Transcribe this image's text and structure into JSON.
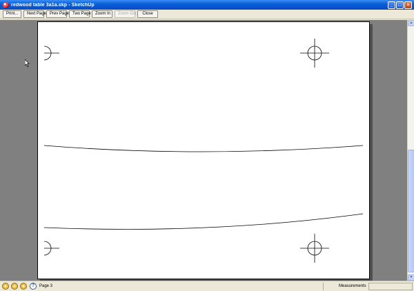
{
  "window": {
    "title": "redwood table 3a1a.skp - SketchUp",
    "minimize_glyph": "_",
    "maximize_glyph": "□",
    "close_glyph": "×"
  },
  "toolbar": {
    "buttons": [
      {
        "label": "Print...",
        "enabled": true
      },
      {
        "label": "Next Page",
        "enabled": true
      },
      {
        "label": "Prev Page",
        "enabled": true
      },
      {
        "label": "Two Page",
        "enabled": true
      },
      {
        "label": "Zoom In",
        "enabled": true
      },
      {
        "label": "Zoom Out",
        "enabled": false
      },
      {
        "label": "Close",
        "enabled": true
      }
    ]
  },
  "statusbar": {
    "page": "Page 3",
    "measurements_label": "Measurements",
    "measurements_value": "",
    "help_glyph": "?"
  },
  "scrollbar": {
    "up_glyph": "▲",
    "down_glyph": "▼"
  }
}
